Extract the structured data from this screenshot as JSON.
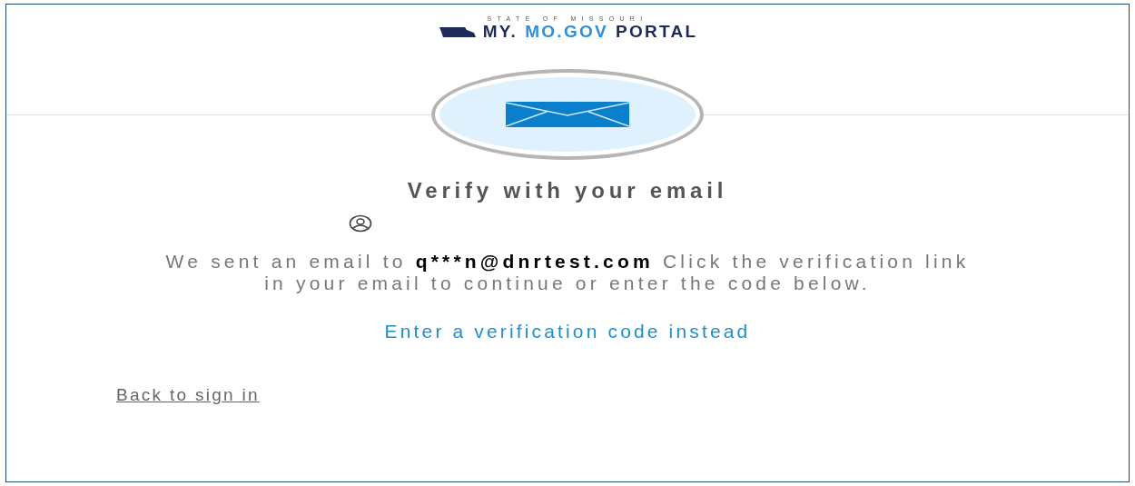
{
  "logo": {
    "tagline": "STATE OF MISSOURI",
    "wordmark": [
      {
        "text": "MY.",
        "kind": "dark"
      },
      {
        "text": "MO.GOV",
        "kind": "light"
      },
      {
        "text": "PORTAL",
        "kind": "dark"
      }
    ]
  },
  "title": "Verify with your email",
  "message": {
    "prefix": "We sent an email to",
    "email": "q***n@dnrtest.com",
    "instructions": "Click the verification link in your email to continue or enter the code below."
  },
  "code_link": "Enter a verification code instead",
  "back_link": "Back to sign in"
}
